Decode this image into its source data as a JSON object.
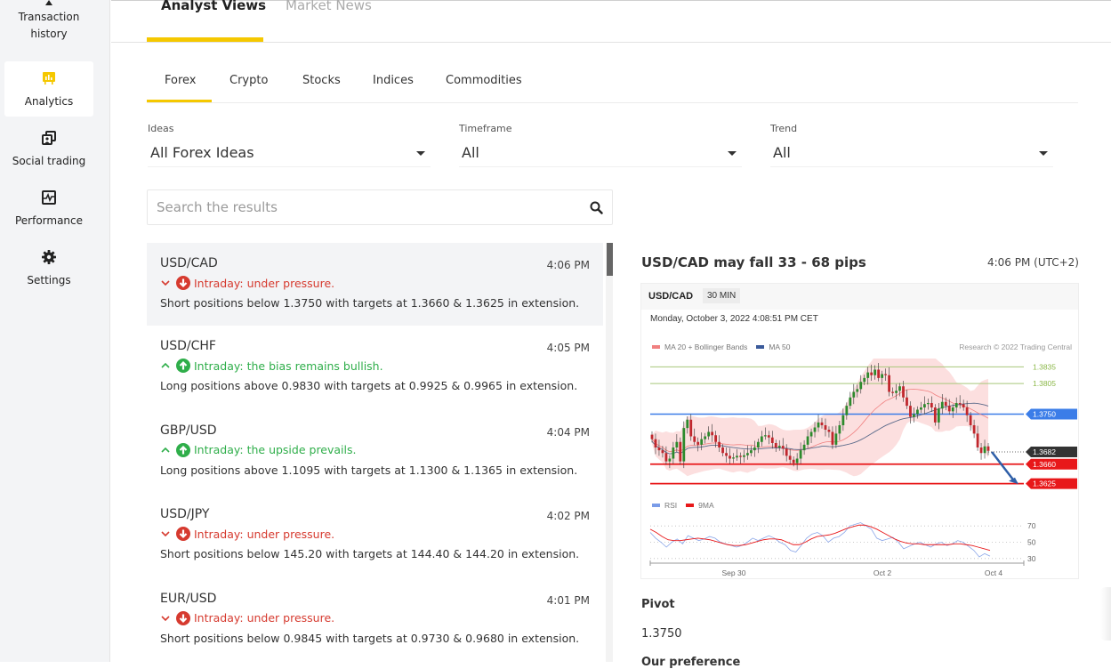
{
  "sidebar": {
    "items": [
      {
        "label": "Transaction history",
        "icon": "transaction-history-icon",
        "active": false
      },
      {
        "label": "Analytics",
        "icon": "analytics-icon",
        "active": true
      },
      {
        "label": "Social trading",
        "icon": "social-trading-icon",
        "active": false
      },
      {
        "label": "Performance",
        "icon": "performance-icon",
        "active": false
      },
      {
        "label": "Settings",
        "icon": "gear-icon",
        "active": false
      }
    ],
    "accent": "#f5c800"
  },
  "main_tabs": [
    {
      "label": "Analyst Views",
      "active": true
    },
    {
      "label": "Market News",
      "active": false
    }
  ],
  "sub_tabs": [
    {
      "label": "Forex",
      "active": true
    },
    {
      "label": "Crypto",
      "active": false
    },
    {
      "label": "Stocks",
      "active": false
    },
    {
      "label": "Indices",
      "active": false
    },
    {
      "label": "Commodities",
      "active": false
    }
  ],
  "filters": {
    "ideas": {
      "label": "Ideas",
      "value": "All Forex Ideas"
    },
    "timeframe": {
      "label": "Timeframe",
      "value": "All"
    },
    "trend": {
      "label": "Trend",
      "value": "All"
    }
  },
  "search": {
    "placeholder": "Search the results",
    "value": ""
  },
  "ideas": [
    {
      "pair": "USD/CAD",
      "time": "4:06 PM",
      "direction": "down",
      "trend": "Intraday: under pressure.",
      "desc": "Short positions below 1.3750 with targets at 1.3660 & 1.3625 in extension.",
      "selected": true
    },
    {
      "pair": "USD/CHF",
      "time": "4:05 PM",
      "direction": "up",
      "trend": "Intraday: the bias remains bullish.",
      "desc": "Long positions above 0.9830 with targets at 0.9925 & 0.9965 in extension.",
      "selected": false
    },
    {
      "pair": "GBP/USD",
      "time": "4:04 PM",
      "direction": "up",
      "trend": "Intraday: the upside prevails.",
      "desc": "Long positions above 1.1095 with targets at 1.1300 & 1.1365 in extension.",
      "selected": false
    },
    {
      "pair": "USD/JPY",
      "time": "4:02 PM",
      "direction": "down",
      "trend": "Intraday: under pressure.",
      "desc": "Short positions below 145.20 with targets at 144.40 & 144.20 in extension.",
      "selected": false
    },
    {
      "pair": "EUR/USD",
      "time": "4:01 PM",
      "direction": "down",
      "trend": "Intraday: under pressure.",
      "desc": "Short positions below 0.9845 with targets at 0.9730 & 0.9680 in extension.",
      "selected": false
    }
  ],
  "detail": {
    "title": "USD/CAD may fall 33 - 68 pips",
    "time": "4:06 PM (UTC+2)",
    "pivot_label": "Pivot",
    "pivot_value": "1.3750",
    "preference_label": "Our preference"
  },
  "colors": {
    "down": "#d63a2f",
    "up": "#2fae4a",
    "pivot_line": "#3b7de8",
    "target_line": "#e8181a",
    "resistance_line": "#a8c77a",
    "current_price": "#333333"
  },
  "chart_data": {
    "type": "candlestick",
    "symbol": "USD/CAD",
    "timeframe": "30 MIN",
    "date_label": "Monday, October 3, 2022 4:08:51 PM CET",
    "credit": "Research © 2022 Trading Central",
    "legend": [
      {
        "name": "MA 20 + Bollinger Bands",
        "color": "#f08080"
      },
      {
        "name": "MA 50",
        "color": "#3a5a9a"
      }
    ],
    "levels": [
      {
        "value": 1.3835,
        "label": "1.3835",
        "kind": "resistance"
      },
      {
        "value": 1.3805,
        "label": "1.3805",
        "kind": "resistance"
      },
      {
        "value": 1.375,
        "label": "1.3750",
        "kind": "pivot"
      },
      {
        "value": 1.3682,
        "label": "1.3682",
        "kind": "current"
      },
      {
        "value": 1.366,
        "label": "1.3660",
        "kind": "target"
      },
      {
        "value": 1.3625,
        "label": "1.3625",
        "kind": "target"
      }
    ],
    "y_range": [
      1.361,
      1.385
    ],
    "closes": [
      1.3705,
      1.369,
      1.3685,
      1.368,
      1.3665,
      1.367,
      1.369,
      1.37,
      1.3665,
      1.3725,
      1.374,
      1.371,
      1.37,
      1.3695,
      1.3705,
      1.371,
      1.3718,
      1.3712,
      1.37,
      1.369,
      1.368,
      1.3675,
      1.367,
      1.3672,
      1.3675,
      1.3673,
      1.3676,
      1.368,
      1.3685,
      1.369,
      1.37,
      1.371,
      1.3712,
      1.3708,
      1.3698,
      1.369,
      1.3693,
      1.3688,
      1.3675,
      1.3668,
      1.3662,
      1.367,
      1.3685,
      1.3695,
      1.371,
      1.3718,
      1.3726,
      1.3735,
      1.373,
      1.3722,
      1.3718,
      1.3695,
      1.3715,
      1.373,
      1.3748,
      1.3765,
      1.378,
      1.379,
      1.3795,
      1.3808,
      1.3815,
      1.3825,
      1.382,
      1.383,
      1.3815,
      1.3822,
      1.382,
      1.379,
      1.3788,
      1.3792,
      1.38,
      1.378,
      1.3765,
      1.3745,
      1.375,
      1.3758,
      1.3762,
      1.3768,
      1.377,
      1.3762,
      1.3735,
      1.376,
      1.3772,
      1.3765,
      1.3755,
      1.3762,
      1.377,
      1.3768,
      1.3762,
      1.3748,
      1.373,
      1.3715,
      1.369,
      1.368,
      1.3692,
      1.3684
    ],
    "rsi": {
      "legend": [
        {
          "name": "RSI",
          "color": "#7a9ce8"
        },
        {
          "name": "9MA",
          "color": "#e8181a"
        }
      ],
      "y_ticks": [
        70,
        50,
        30
      ],
      "x_ticks": [
        "Sep 30",
        "Oct 2",
        "Oct 4"
      ],
      "rsi_values": [
        62,
        55,
        50,
        44,
        50,
        54,
        48,
        58,
        55,
        52,
        54,
        57,
        55,
        50,
        48,
        46,
        44,
        46,
        50,
        55,
        52,
        55,
        58,
        55,
        50,
        47,
        40,
        38,
        46,
        55,
        60,
        62,
        58,
        50,
        55,
        57,
        62,
        70,
        72,
        74,
        70,
        66,
        55,
        52,
        54,
        56,
        50,
        42,
        45,
        48,
        50,
        47,
        44,
        48,
        50,
        46,
        48,
        52,
        50,
        45,
        40,
        32,
        36,
        33
      ],
      "ma_values": [
        66,
        62,
        57,
        53,
        52,
        52,
        53,
        54,
        55,
        54,
        53,
        51,
        49,
        47,
        46,
        46,
        47,
        49,
        51,
        53,
        54,
        54,
        53,
        50,
        47,
        47,
        50,
        54,
        57,
        58,
        59,
        61,
        64,
        67,
        69,
        71,
        71,
        69,
        66,
        62,
        58,
        54,
        51,
        49,
        48,
        48,
        47,
        47,
        47,
        47,
        47,
        48,
        48,
        47,
        46,
        44,
        42,
        40
      ]
    }
  }
}
